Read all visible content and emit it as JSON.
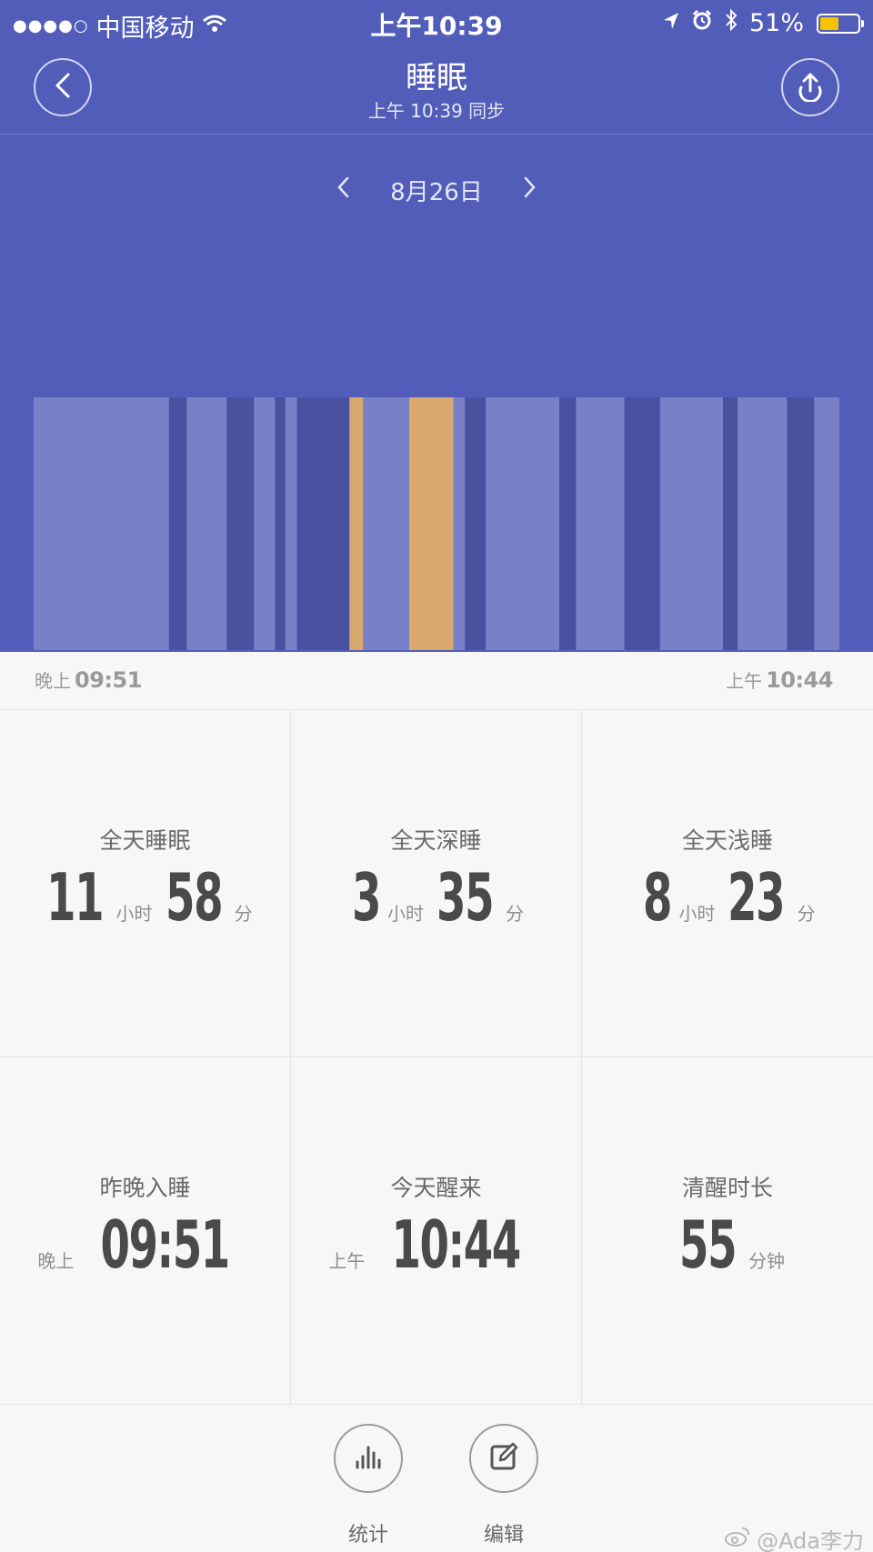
{
  "status_bar": {
    "signal_dots": "●●●●○",
    "carrier": "中国移动",
    "time": "上午10:39",
    "battery_percent": "51%",
    "battery_level": 0.51,
    "battery_color": "#f5c400"
  },
  "header": {
    "title": "睡眠",
    "subtitle": "上午 10:39 同步",
    "back_icon": "chevron-left-icon",
    "share_icon": "upload-icon"
  },
  "date_nav": {
    "date": "8月26日",
    "prev_icon": "chevron-left-icon",
    "next_icon": "chevron-right-icon"
  },
  "colors": {
    "background": "#525dba",
    "light_sleep": "#7880c8",
    "deep_sleep": "#4a51a0",
    "awake": "#d9a86c"
  },
  "chart_data": {
    "type": "bar",
    "description_axis": "time from 21:51 to 10:44, sleep stage per segment",
    "start": "21:51",
    "end": "10:44",
    "segments": [
      {
        "stage": "light",
        "minutes": 129
      },
      {
        "stage": "deep",
        "minutes": 17
      },
      {
        "stage": "light",
        "minutes": 38
      },
      {
        "stage": "deep",
        "minutes": 26
      },
      {
        "stage": "light",
        "minutes": 20
      },
      {
        "stage": "deep",
        "minutes": 10
      },
      {
        "stage": "light",
        "minutes": 11
      },
      {
        "stage": "deep",
        "minutes": 50
      },
      {
        "stage": "awake",
        "minutes": 13
      },
      {
        "stage": "light",
        "minutes": 44
      },
      {
        "stage": "awake",
        "minutes": 42
      },
      {
        "stage": "light",
        "minutes": 11
      },
      {
        "stage": "deep",
        "minutes": 20
      },
      {
        "stage": "light",
        "minutes": 70
      },
      {
        "stage": "deep",
        "minutes": 16
      },
      {
        "stage": "light",
        "minutes": 46
      },
      {
        "stage": "deep",
        "minutes": 34
      },
      {
        "stage": "light",
        "minutes": 60
      },
      {
        "stage": "deep",
        "minutes": 14
      },
      {
        "stage": "light",
        "minutes": 47
      },
      {
        "stage": "deep",
        "minutes": 26
      },
      {
        "stage": "light",
        "minutes": 24
      }
    ]
  },
  "axis": {
    "start_prefix": "晚上",
    "start_time": "09:51",
    "end_prefix": "上午",
    "end_time": "10:44"
  },
  "stats": {
    "total": {
      "label": "全天睡眠",
      "hours": "11",
      "hours_unit": "小时",
      "minutes": "58",
      "minutes_unit": "分"
    },
    "deep": {
      "label": "全天深睡",
      "hours": "3",
      "hours_unit": "小时",
      "minutes": "35",
      "minutes_unit": "分"
    },
    "light": {
      "label": "全天浅睡",
      "hours": "8",
      "hours_unit": "小时",
      "minutes": "23",
      "minutes_unit": "分"
    },
    "fell_asleep": {
      "label": "昨晚入睡",
      "prefix": "晚上",
      "time": "09:51"
    },
    "woke_up": {
      "label": "今天醒来",
      "prefix": "上午",
      "time": "10:44"
    },
    "awake": {
      "label": "清醒时长",
      "value": "55",
      "unit": "分钟"
    }
  },
  "bottom_bar": {
    "stats_label": "统计",
    "stats_icon": "bar-chart-icon",
    "edit_label": "编辑",
    "edit_icon": "edit-icon",
    "watermark": "@Ada李力"
  }
}
